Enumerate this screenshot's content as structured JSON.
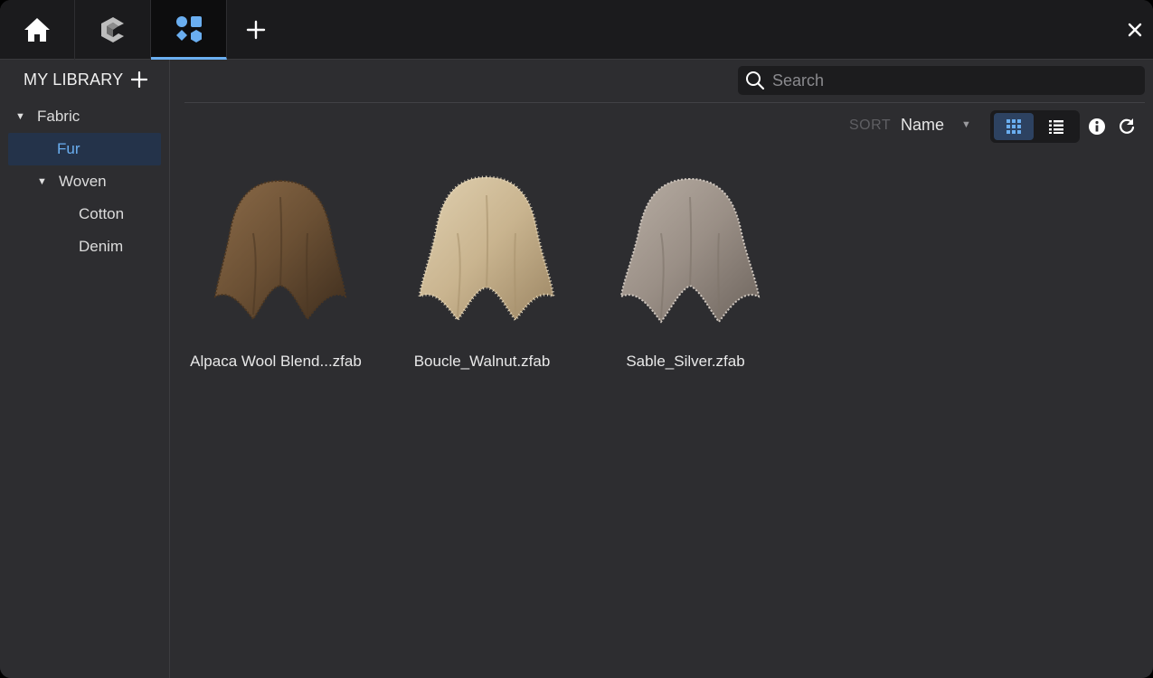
{
  "tabs": [
    {
      "name": "home",
      "icon": "home-icon"
    },
    {
      "name": "clo",
      "icon": "clo-logo-icon"
    },
    {
      "name": "library",
      "icon": "shapes-icon",
      "active": true
    }
  ],
  "accent_color": "#6aaef0",
  "sidebar": {
    "title": "MY LIBRARY",
    "tree": [
      {
        "label": "Fabric",
        "expanded": true
      },
      {
        "label": "Fur",
        "selected": true
      },
      {
        "label": "Woven",
        "expanded": true
      },
      {
        "label": "Cotton"
      },
      {
        "label": "Denim"
      }
    ]
  },
  "search": {
    "placeholder": "Search",
    "value": ""
  },
  "toolbar": {
    "sort_label": "SORT",
    "sort_value": "Name",
    "view_mode": "grid"
  },
  "items": [
    {
      "name": "Alpaca Wool Blend...zfab",
      "color": "#6b5034"
    },
    {
      "name": "Boucle_Walnut.zfab",
      "color": "#c9b48f"
    },
    {
      "name": "Sable_Silver.zfab",
      "color": "#9a8f86"
    }
  ]
}
